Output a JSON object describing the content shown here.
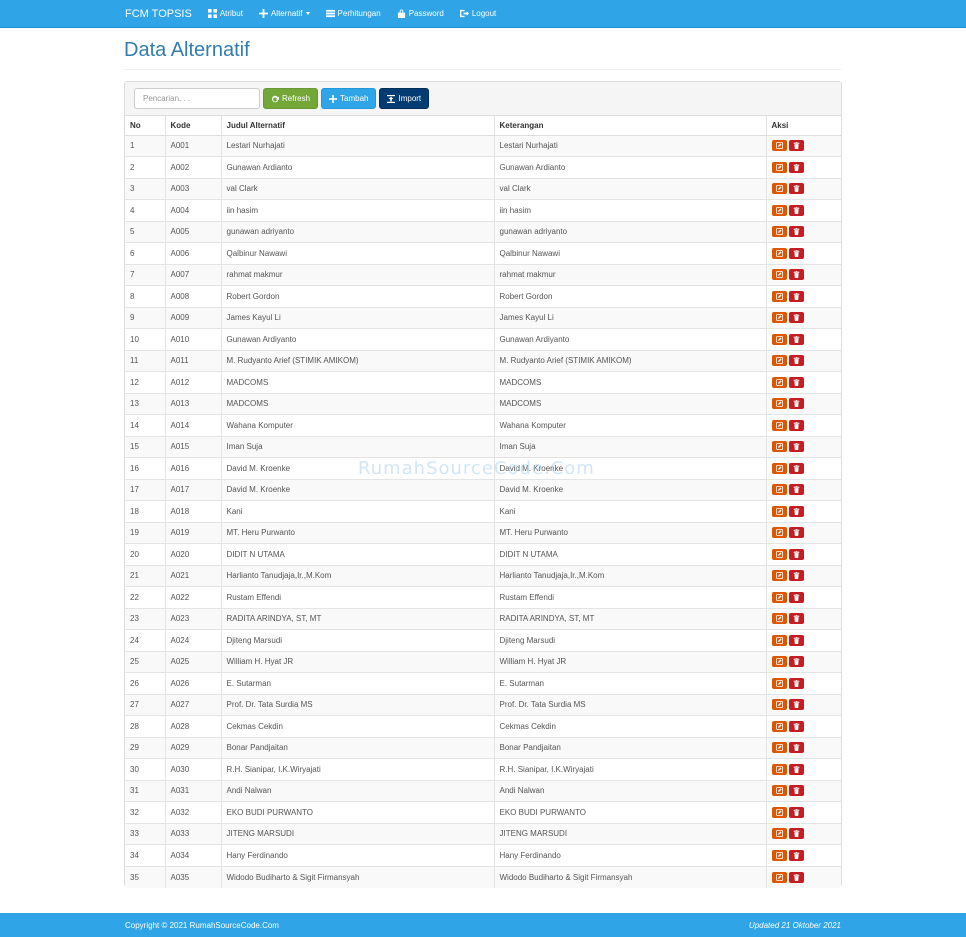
{
  "navbar": {
    "brand": "FCM TOPSIS",
    "items": [
      {
        "label": "Atribut",
        "icon": "th-large-icon"
      },
      {
        "label": "Alternatif",
        "icon": "plus-icon",
        "dropdown": true
      },
      {
        "label": "Perhitungan",
        "icon": "list-icon"
      },
      {
        "label": "Password",
        "icon": "lock-icon"
      },
      {
        "label": "Logout",
        "icon": "logout-icon"
      }
    ]
  },
  "page": {
    "title": "Data Alternatif"
  },
  "toolbar": {
    "search_placeholder": "Pencarian. . .",
    "refresh_label": "Refresh",
    "tambah_label": "Tambah",
    "import_label": "Import"
  },
  "table": {
    "headers": [
      "No",
      "Kode",
      "Judul Alternatif",
      "Keterangan",
      "Aksi"
    ],
    "rows": [
      [
        "1",
        "A001",
        "Lestari Nurhajati",
        "Lestari Nurhajati"
      ],
      [
        "2",
        "A002",
        "Gunawan Ardianto",
        "Gunawan Ardianto"
      ],
      [
        "3",
        "A003",
        "val Clark",
        "val Clark"
      ],
      [
        "4",
        "A004",
        "iin hasim",
        "iin hasim"
      ],
      [
        "5",
        "A005",
        "gunawan adriyanto",
        "gunawan adriyanto"
      ],
      [
        "6",
        "A006",
        "Qalbinur Nawawi",
        "Qalbinur Nawawi"
      ],
      [
        "7",
        "A007",
        "rahmat makmur",
        "rahmat makmur"
      ],
      [
        "8",
        "A008",
        "Robert Gordon",
        "Robert Gordon"
      ],
      [
        "9",
        "A009",
        "James Kayul Li",
        "James Kayul Li"
      ],
      [
        "10",
        "A010",
        "Gunawan Ardiyanto",
        "Gunawan Ardiyanto"
      ],
      [
        "11",
        "A011",
        "M. Rudyanto Arief (STIMIK AMIKOM)",
        "M. Rudyanto Arief (STIMIK AMIKOM)"
      ],
      [
        "12",
        "A012",
        "MADCOMS",
        "MADCOMS"
      ],
      [
        "13",
        "A013",
        "MADCOMS",
        "MADCOMS"
      ],
      [
        "14",
        "A014",
        "Wahana Komputer",
        "Wahana Komputer"
      ],
      [
        "15",
        "A015",
        "Iman Suja",
        "Iman Suja"
      ],
      [
        "16",
        "A016",
        "David M. Kroenke",
        "David M. Kroenke"
      ],
      [
        "17",
        "A017",
        "David M. Kroenke",
        "David M. Kroenke"
      ],
      [
        "18",
        "A018",
        "Kani",
        "Kani"
      ],
      [
        "19",
        "A019",
        "MT. Heru Purwanto",
        "MT. Heru Purwanto"
      ],
      [
        "20",
        "A020",
        "DIDIT N UTAMA",
        "DIDIT N UTAMA"
      ],
      [
        "21",
        "A021",
        "Harlianto Tanudjaja,Ir.,M.Kom",
        "Harlianto Tanudjaja,Ir.,M.Kom"
      ],
      [
        "22",
        "A022",
        "Rustam Effendi",
        "Rustam Effendi"
      ],
      [
        "23",
        "A023",
        "RADITA ARINDYA, ST, MT",
        "RADITA ARINDYA, ST, MT"
      ],
      [
        "24",
        "A024",
        "Djiteng Marsudi",
        "Djiteng Marsudi"
      ],
      [
        "25",
        "A025",
        "William H. Hyat JR",
        "William H. Hyat JR"
      ],
      [
        "26",
        "A026",
        "E. Sutarman",
        "E. Sutarman"
      ],
      [
        "27",
        "A027",
        "Prof. Dr. Tata Surdia MS",
        "Prof. Dr. Tata Surdia MS"
      ],
      [
        "28",
        "A028",
        "Cekmas Cekdin",
        "Cekmas Cekdin"
      ],
      [
        "29",
        "A029",
        "Bonar Pandjaitan",
        "Bonar Pandjaitan"
      ],
      [
        "30",
        "A030",
        "R.H. Sianipar, I.K.Wiryajati",
        "R.H. Sianipar, I.K.Wiryajati"
      ],
      [
        "31",
        "A031",
        "Andi Nalwan",
        "Andi Nalwan"
      ],
      [
        "32",
        "A032",
        "EKO BUDI PURWANTO",
        "EKO BUDI PURWANTO"
      ],
      [
        "33",
        "A033",
        "JITENG MARSUDI",
        "JITENG MARSUDI"
      ],
      [
        "34",
        "A034",
        "Hany Ferdinando",
        "Hany Ferdinando"
      ],
      [
        "35",
        "A035",
        "Widodo Budiharto & Sigit Firmansyah",
        "Widodo Budiharto & Sigit Firmansyah"
      ]
    ]
  },
  "watermark": "RumahSourceCode.Com",
  "footer": {
    "copyright": "Copyright © 2021 RumahSourceCode.Com",
    "updated": "Updated 21 Oktober 2021"
  },
  "colors": {
    "primary": "#2fa4e7",
    "success": "#73a839",
    "dark": "#033c73",
    "edit": "#dd5600",
    "delete": "#c71c22",
    "title": "#317eac"
  }
}
